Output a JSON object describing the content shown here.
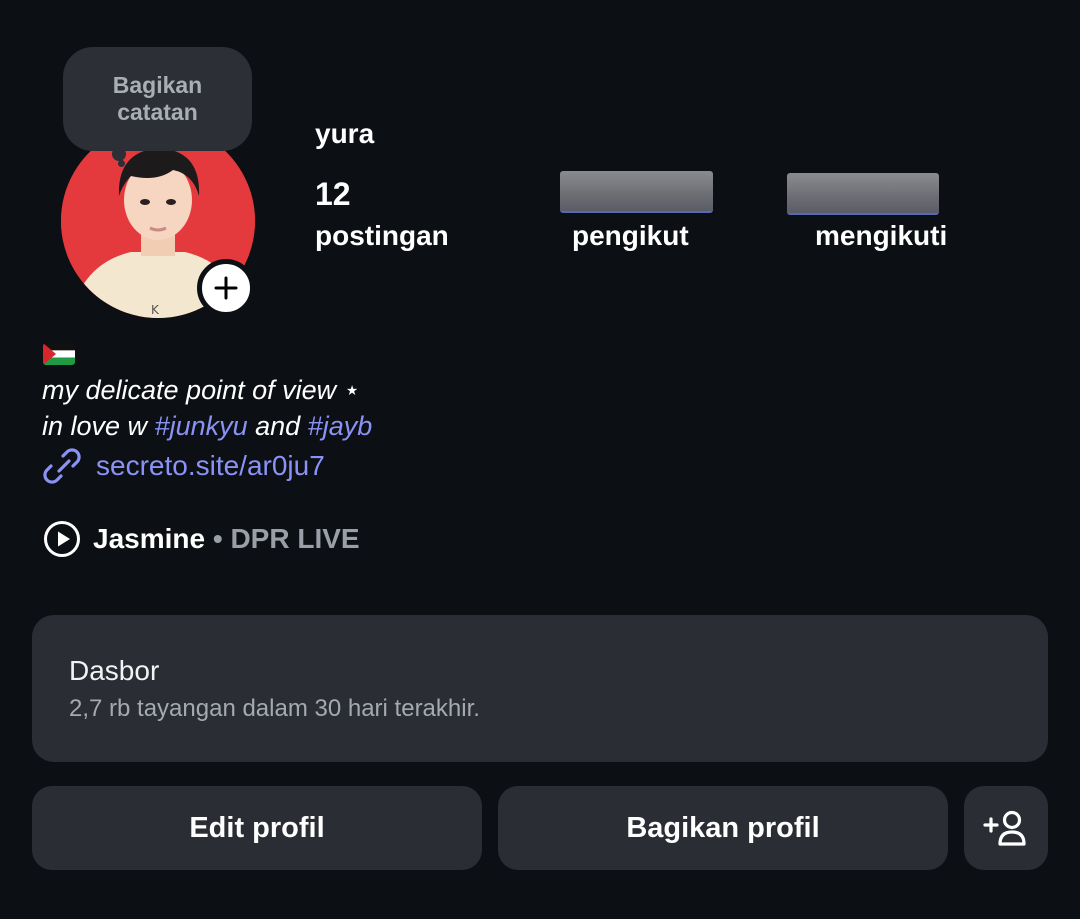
{
  "note": {
    "text": "Bagikan catatan"
  },
  "profile": {
    "username": "yura",
    "posts_count": "12",
    "posts_label": "postingan",
    "followers_label": "pengikut",
    "following_label": "mengikuti"
  },
  "bio": {
    "flag_icon": "palestine-flag-icon",
    "line1": "my delicate point of view ⋆",
    "line2_prefix": "in love w ",
    "hashtag1": "#junkyu",
    "line2_middle": " and ",
    "hashtag2": "#jayb",
    "link": "secreto.site/ar0ju7"
  },
  "music": {
    "title": "Jasmine",
    "separator": " • ",
    "artist": "DPR LIVE"
  },
  "dashboard": {
    "title": "Dasbor",
    "subtitle": "2,7 rb tayangan dalam 30 hari terakhir."
  },
  "actions": {
    "edit_label": "Edit profil",
    "share_label": "Bagikan profil",
    "discover_icon": "add-person-icon"
  },
  "colors": {
    "background": "#0c0f14",
    "card": "#2a2d33",
    "accent_link": "#8a93f5"
  }
}
